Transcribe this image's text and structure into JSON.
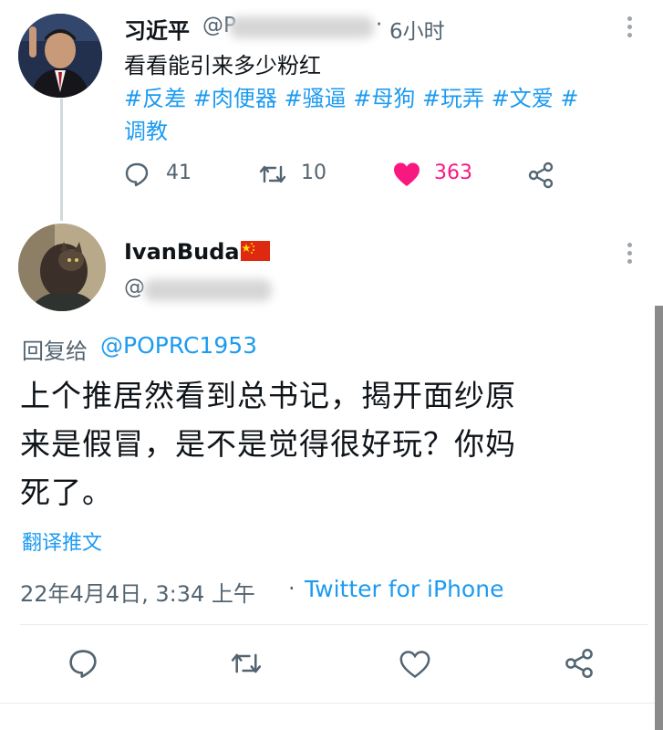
{
  "original_tweet": {
    "author_name": "习近平",
    "handle_visible": "@P",
    "time": "6小时",
    "text": "看看能引来多少粉红",
    "hashtags_line1": "#反差 #肉便器 #骚逼 #母狗 #玩弄 #文爱 #",
    "hashtags_line2": "调教",
    "replies": "41",
    "retweets": "10",
    "likes": "363"
  },
  "reply_tweet": {
    "author_name": "IvanBuda",
    "flag": "china-flag-icon",
    "handle_visible": "@",
    "reply_label": "回复给",
    "reply_to": "@POPRC1953",
    "text_line1": "上个推居然看到总书记，揭开面纱原",
    "text_line2": "来是假冒，是不是觉得很好玩？你妈",
    "text_line3": "死了。",
    "translate": "翻译推文",
    "timestamp": "22年4月4日, 3:34 上午",
    "separator": "·",
    "client": "Twitter for iPhone"
  },
  "colors": {
    "link": "#1d9bf0",
    "like": "#f91880",
    "muted": "#536471"
  }
}
